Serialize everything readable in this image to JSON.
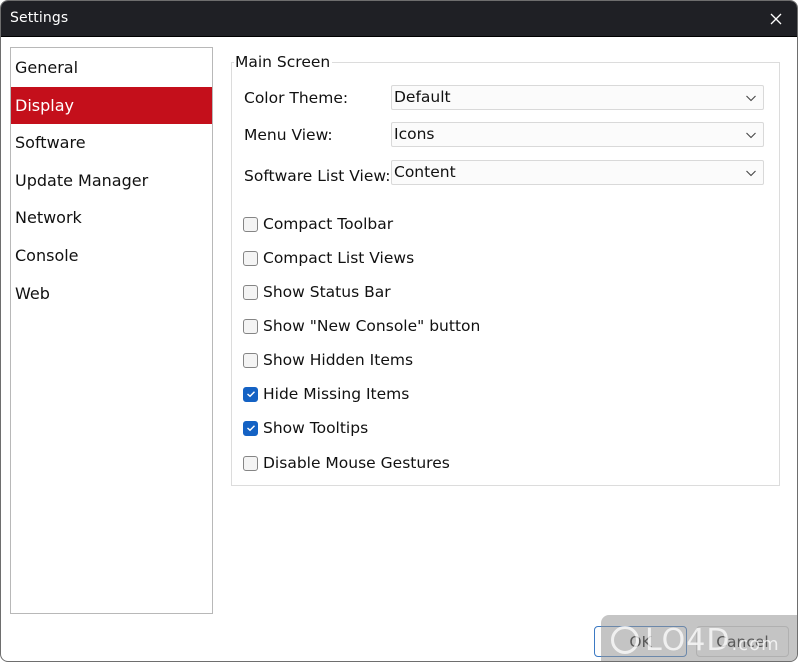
{
  "window": {
    "title": "Settings",
    "close_icon": "close-icon"
  },
  "sidebar": {
    "selected": "Display",
    "accent_color": "#c40f1b",
    "items": [
      {
        "label": "General",
        "active": false
      },
      {
        "label": "Display",
        "active": true
      },
      {
        "label": "Software",
        "active": false
      },
      {
        "label": "Update Manager",
        "active": false
      },
      {
        "label": "Network",
        "active": false
      },
      {
        "label": "Console",
        "active": false
      },
      {
        "label": "Web",
        "active": false
      }
    ]
  },
  "main_screen": {
    "group_title": "Main Screen",
    "fields": [
      {
        "label": "Color Theme:",
        "value": "Default"
      },
      {
        "label": "Menu View:",
        "value": "Icons"
      },
      {
        "label": "Software List View:",
        "value": "Content"
      }
    ],
    "checkboxes": [
      {
        "label": "Compact Toolbar",
        "checked": false
      },
      {
        "label": "Compact List Views",
        "checked": false
      },
      {
        "label": "Show Status Bar",
        "checked": false
      },
      {
        "label": "Show \"New Console\" button",
        "checked": false
      },
      {
        "label": "Show Hidden Items",
        "checked": false
      },
      {
        "label": "Hide Missing Items",
        "checked": true
      },
      {
        "label": "Show Tooltips",
        "checked": true
      },
      {
        "label": "Disable Mouse Gestures",
        "checked": false
      }
    ],
    "checkbox_accent_color": "#1462c4"
  },
  "footer": {
    "ok_label": "OK",
    "cancel_label": "Cancel"
  },
  "watermark": {
    "text": "LO4D",
    "suffix": ".com"
  }
}
